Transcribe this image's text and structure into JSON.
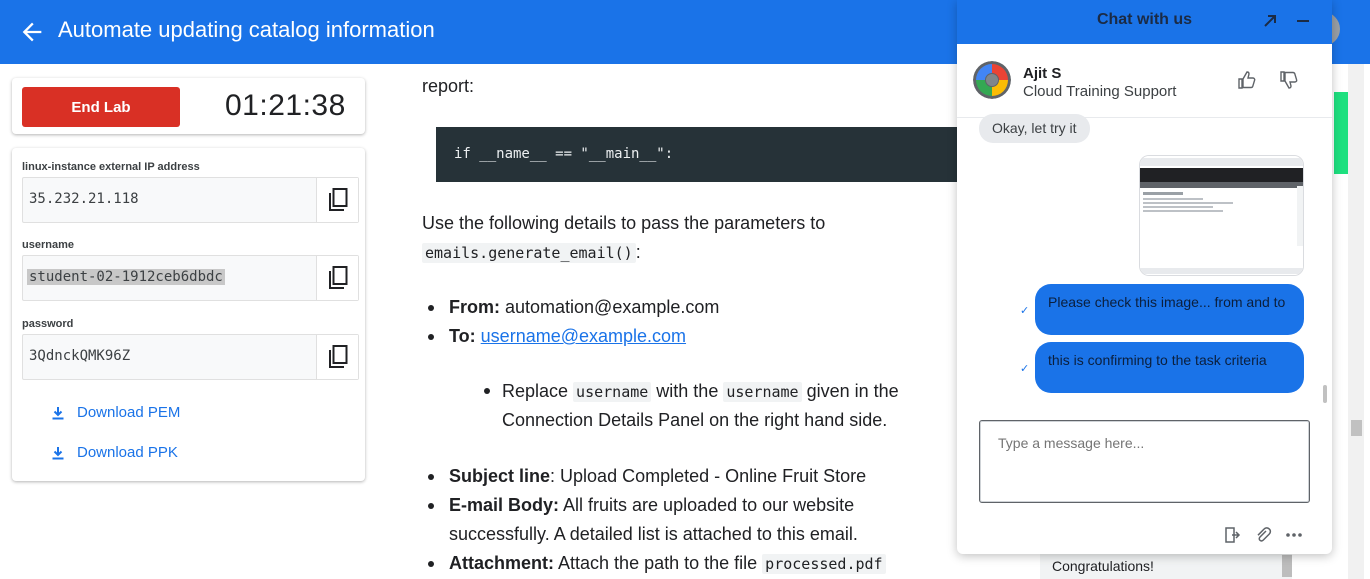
{
  "header": {
    "title": "Automate updating catalog information"
  },
  "lab": {
    "end_label": "End Lab",
    "timer": "01:21:38",
    "fields": [
      {
        "label": "linux-instance external IP address",
        "value": "35.232.21.118"
      },
      {
        "label": "username",
        "value": "student-02-1912ceb6dbdc"
      },
      {
        "label": "password",
        "value": "3QdnckQMK96Z"
      }
    ],
    "download_pem": "Download PEM",
    "download_ppk": "Download PPK"
  },
  "content": {
    "report_text": "report:",
    "code_line": "if __name__ == \"__main__\":",
    "intro": "Use the following details to pass the parameters to",
    "intro_code": "emails.generate_email()",
    "intro_tail": ":",
    "from_label": "From:",
    "from_value": " automation@example.com",
    "to_label": "To:",
    "to_value": "username@example.com",
    "replace_pre": "Replace ",
    "replace_code1": "username",
    "replace_mid": " with the ",
    "replace_code2": "username",
    "replace_post": " given in the",
    "replace_line2": "Connection Details Panel on the right hand side.",
    "subject_label": "Subject line",
    "subject_value": ": Upload Completed - Online Fruit Store",
    "body_label": "E-mail Body:",
    "body_value": " All fruits are uploaded to our website",
    "body_line2": "successfully. A detailed list is attached to this email.",
    "attach_label": "Attachment:",
    "attach_value": " Attach the path to the file ",
    "attach_code": "processed.pdf"
  },
  "side": {
    "congrats": "Congratulations!"
  },
  "chat": {
    "title": "Chat with us",
    "agent_name": "Ajit S",
    "agent_role": "Cloud Training Support",
    "messages": [
      {
        "from": "agent",
        "text": "Okay, let try it"
      },
      {
        "from": "user",
        "text": "Please check this image... from and to"
      },
      {
        "from": "user",
        "text": "this is confirming to the task criteria"
      }
    ],
    "input_placeholder": "Type a message here...",
    "colors": {
      "header": "#1a73e8",
      "user_bubble": "#1a73e8"
    }
  }
}
